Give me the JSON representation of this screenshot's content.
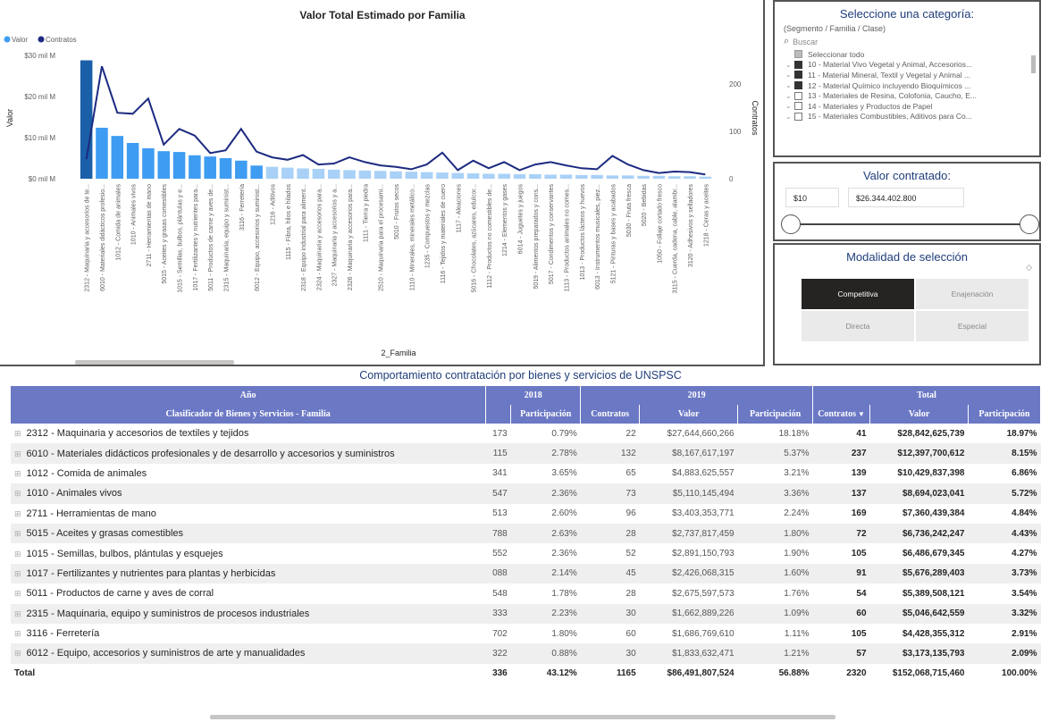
{
  "chart": {
    "title": "Valor Total Estimado por Familia",
    "legend": [
      "Valor",
      "Contratos"
    ],
    "xlabel": "2_Familia",
    "ylabel_left": "Valor",
    "ylabel_right": "Contratos",
    "left_ticks": [
      "$30 mil M",
      "$20 mil M",
      "$10 mil M",
      "$0 mil M"
    ],
    "right_ticks": [
      "200",
      "100",
      "0"
    ],
    "colors": {
      "bar": "#3e9cf2",
      "bar_selected": "#1a5fa8",
      "bar_light": "#a9d1f7",
      "line": "#1c2a80"
    }
  },
  "chart_data": {
    "type": "bar",
    "title": "Valor Total Estimado por Familia",
    "xlabel": "2_Familia",
    "ylabel": "Valor",
    "y2label": "Contratos",
    "ylim": [
      0,
      30
    ],
    "y2lim": [
      0,
      260
    ],
    "categories": [
      "2312 - Maquinaria y accesorios de te...",
      "6010 - Materiales didácticos profesio...",
      "1012 - Comida de animales",
      "1010 - Animales vivos",
      "2711 - Herramientas de mano",
      "5015 - Aceites y grasas comestibles",
      "1015 - Semillas, bulbos, plántulas y e...",
      "1017 - Fertilizantes y nutrientes para...",
      "5011 - Productos de carne y aves de...",
      "2315 - Maquinaria, equipo y suminist...",
      "3116 - Ferretería",
      "6012 - Equipo, accesorios y suminist...",
      "1216 - Aditivos",
      "1115 - Fibra, hilos e hilados",
      "2318 - Equipo industrial para aliment...",
      "2324 - Maquinaria y accesorios para...",
      "2327 - Maquinaria y accesorios y a...",
      "2326 - Maquinaria y accesorios para...",
      "1111 - Tierra y piedra",
      "2510 - Maquinaria para el procesami...",
      "5010 - Frutos secos",
      "1110 - Minerales, minerales metálico...",
      "1235 - Compuestos y mezclas",
      "1116 - Tejidos y materiales de cuero",
      "1117 - Aleaciones",
      "5016 - Chocolates, azúcares, edulcor...",
      "1112 - Productos no comestibles de...",
      "1214 - Elementos y gases",
      "6014 - Juguetes y juegos",
      "5019 - Alimentos preparados y cons...",
      "5017 - Condimentos y conservantes",
      "1113 - Productos animales no comes...",
      "1013 - Productos lácteos y huevos",
      "6013 - Instrumentos musicales, piez...",
      "5121 - Pinturas y bases y acabados",
      "5030 - Fruta fresca",
      "5020 - Bebidas",
      "1050 - Follaje cortado fresco",
      "3115 - Cuerda, cadena, cable, alambr...",
      "3120 - Adhesivos y selladores",
      "1218 - Ceras y aceites"
    ],
    "series": [
      {
        "name": "Valor",
        "values": [
          28.8,
          12.4,
          10.4,
          8.7,
          7.4,
          6.7,
          6.5,
          5.7,
          5.4,
          5.0,
          4.4,
          3.2,
          2.9,
          2.7,
          2.5,
          2.4,
          2.2,
          2.1,
          2.0,
          1.9,
          1.8,
          1.7,
          1.6,
          1.5,
          1.4,
          1.3,
          1.2,
          1.2,
          1.1,
          1.1,
          1.0,
          1.0,
          0.9,
          0.9,
          0.8,
          0.8,
          0.7,
          0.7,
          0.6,
          0.6,
          0.5
        ]
      },
      {
        "name": "Contratos",
        "values": [
          41,
          237,
          139,
          137,
          169,
          72,
          105,
          91,
          54,
          60,
          105,
          57,
          45,
          40,
          50,
          30,
          32,
          45,
          35,
          28,
          25,
          20,
          30,
          55,
          18,
          38,
          22,
          35,
          18,
          30,
          35,
          28,
          22,
          20,
          48,
          30,
          18,
          12,
          15,
          14,
          9
        ]
      }
    ]
  },
  "slicer_category": {
    "title": "Seleccione una categoría:",
    "hint": "(Segmento / Familia / Clase)",
    "search_placeholder": "Buscar",
    "items": [
      {
        "label": "Seleccionar todo",
        "state": "partial",
        "chev": ""
      },
      {
        "label": "10 - Material Vivo Vegetal y Animal, Accesorios...",
        "state": "on",
        "chev": "⌄"
      },
      {
        "label": "11 - Material Mineral, Textil y Vegetal y Animal ...",
        "state": "on",
        "chev": "⌄"
      },
      {
        "label": "12 - Material Químico incluyendo Bioquímicos ...",
        "state": "on",
        "chev": "⌄"
      },
      {
        "label": "13 - Materiales de Resina, Colofonia, Caucho, E...",
        "state": "off",
        "chev": "⌄"
      },
      {
        "label": "14 - Materiales y Productos de Papel",
        "state": "off",
        "chev": "⌄"
      },
      {
        "label": "15 - Materiales Combustibles, Aditivos para Co...",
        "state": "off",
        "chev": "⌄"
      }
    ]
  },
  "slicer_value": {
    "title": "Valor contratado:",
    "min": "$10",
    "max": "$26.344.402.800"
  },
  "slicer_mode": {
    "title": "Modalidad de selección",
    "options": [
      "Competitiva",
      "Enajenación",
      "Directa",
      "Especial"
    ],
    "selected": "Competitiva"
  },
  "table": {
    "title": "Comportamiento contratación por bienes y servicios de UNSPSC",
    "year_header_label": "Año",
    "years": [
      "2018",
      "2019",
      "Total"
    ],
    "row_header_label": "Clasificador de Bienes y Servicios - Familia",
    "columns": [
      "Participación",
      "Contratos",
      "Valor",
      "Participación",
      "Contratos",
      "Valor",
      "Participación"
    ],
    "rows": [
      {
        "label": "2312 - Maquinaria y accesorios de textiles y tejidos",
        "cut": "173",
        "c2018_part": "0.79%",
        "c2019_contr": "22",
        "c2019_valor": "$27,644,660,266",
        "c2019_part": "18.18%",
        "t_contr": "41",
        "t_valor": "$28,842,625,739",
        "t_part": "18.97%"
      },
      {
        "label": "6010 - Materiales didácticos profesionales y de desarrollo y accesorios y suministros",
        "cut": "115",
        "c2018_part": "2.78%",
        "c2019_contr": "132",
        "c2019_valor": "$8,167,617,197",
        "c2019_part": "5.37%",
        "t_contr": "237",
        "t_valor": "$12,397,700,612",
        "t_part": "8.15%"
      },
      {
        "label": "1012 - Comida de animales",
        "cut": "341",
        "c2018_part": "3.65%",
        "c2019_contr": "65",
        "c2019_valor": "$4,883,625,557",
        "c2019_part": "3.21%",
        "t_contr": "139",
        "t_valor": "$10,429,837,398",
        "t_part": "6.86%"
      },
      {
        "label": "1010 - Animales vivos",
        "cut": "547",
        "c2018_part": "2.36%",
        "c2019_contr": "73",
        "c2019_valor": "$5,110,145,494",
        "c2019_part": "3.36%",
        "t_contr": "137",
        "t_valor": "$8,694,023,041",
        "t_part": "5.72%"
      },
      {
        "label": "2711 - Herramientas de mano",
        "cut": "513",
        "c2018_part": "2.60%",
        "c2019_contr": "96",
        "c2019_valor": "$3,403,353,771",
        "c2019_part": "2.24%",
        "t_contr": "169",
        "t_valor": "$7,360,439,384",
        "t_part": "4.84%"
      },
      {
        "label": "5015 - Aceites y grasas comestibles",
        "cut": "788",
        "c2018_part": "2.63%",
        "c2019_contr": "28",
        "c2019_valor": "$2,737,817,459",
        "c2019_part": "1.80%",
        "t_contr": "72",
        "t_valor": "$6,736,242,247",
        "t_part": "4.43%"
      },
      {
        "label": "1015 - Semillas, bulbos, plántulas y esquejes",
        "cut": "552",
        "c2018_part": "2.36%",
        "c2019_contr": "52",
        "c2019_valor": "$2,891,150,793",
        "c2019_part": "1.90%",
        "t_contr": "105",
        "t_valor": "$6,486,679,345",
        "t_part": "4.27%"
      },
      {
        "label": "1017 - Fertilizantes y nutrientes para plantas y herbicidas",
        "cut": "088",
        "c2018_part": "2.14%",
        "c2019_contr": "45",
        "c2019_valor": "$2,426,068,315",
        "c2019_part": "1.60%",
        "t_contr": "91",
        "t_valor": "$5,676,289,403",
        "t_part": "3.73%"
      },
      {
        "label": "5011 - Productos de carne y aves de corral",
        "cut": "548",
        "c2018_part": "1.78%",
        "c2019_contr": "28",
        "c2019_valor": "$2,675,597,573",
        "c2019_part": "1.76%",
        "t_contr": "54",
        "t_valor": "$5,389,508,121",
        "t_part": "3.54%"
      },
      {
        "label": "2315 - Maquinaria, equipo y suministros de procesos industriales",
        "cut": "333",
        "c2018_part": "2.23%",
        "c2019_contr": "30",
        "c2019_valor": "$1,662,889,226",
        "c2019_part": "1.09%",
        "t_contr": "60",
        "t_valor": "$5,046,642,559",
        "t_part": "3.32%"
      },
      {
        "label": "3116 - Ferretería",
        "cut": "702",
        "c2018_part": "1.80%",
        "c2019_contr": "60",
        "c2019_valor": "$1,686,769,610",
        "c2019_part": "1.11%",
        "t_contr": "105",
        "t_valor": "$4,428,355,312",
        "t_part": "2.91%"
      },
      {
        "label": "6012 - Equipo, accesorios y suministros de arte y manualidades",
        "cut": "322",
        "c2018_part": "0.88%",
        "c2019_contr": "30",
        "c2019_valor": "$1,833,632,471",
        "c2019_part": "1.21%",
        "t_contr": "57",
        "t_valor": "$3,173,135,793",
        "t_part": "2.09%"
      }
    ],
    "total": {
      "label": "Total",
      "cut": "336",
      "c2018_part": "43.12%",
      "c2019_contr": "1165",
      "c2019_valor": "$86,491,807,524",
      "c2019_part": "56.88%",
      "t_contr": "2320",
      "t_valor": "$152,068,715,460",
      "t_part": "100.00%"
    }
  }
}
